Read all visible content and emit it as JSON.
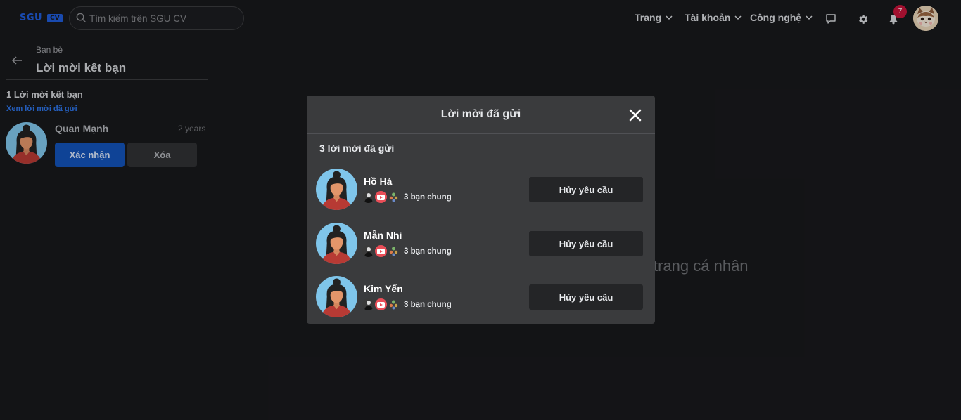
{
  "nav": {
    "logo_text": "SGU",
    "logo_badge": "CV",
    "search_placeholder": "Tìm kiếm trên SGU CV",
    "menus": [
      "Trang",
      "Tài khoản",
      "Công nghệ"
    ],
    "notification_count": "7"
  },
  "sidebar": {
    "breadcrumb": "Bạn bè",
    "title": "Lời mời kết bạn",
    "request_count": "1 Lời mời kết bạn",
    "view_sent_link": "Xem lời mời đã gửi",
    "requests": [
      {
        "name": "Quan Mạnh",
        "time": "2 years",
        "confirm_label": "Xác nhận",
        "delete_label": "Xóa"
      }
    ]
  },
  "background": {
    "hint_text": "trang cá nhân"
  },
  "modal": {
    "title": "Lời mời đã gửi",
    "count_label": "3 lời mời đã gửi",
    "items": [
      {
        "name": "Hồ Hà",
        "mutual": "3 bạn chung",
        "action": "Hủy yêu cầu"
      },
      {
        "name": "Mẫn Nhi",
        "mutual": "3 bạn chung",
        "action": "Hủy yêu cầu"
      },
      {
        "name": "Kim Yến",
        "mutual": "3 bạn chung",
        "action": "Hủy yêu cầu"
      }
    ]
  },
  "colors": {
    "background": "#18191c",
    "accent": "#1352b8",
    "link": "#2d73e6",
    "modal": "#3a3b3d",
    "badge": "#c5143a"
  }
}
